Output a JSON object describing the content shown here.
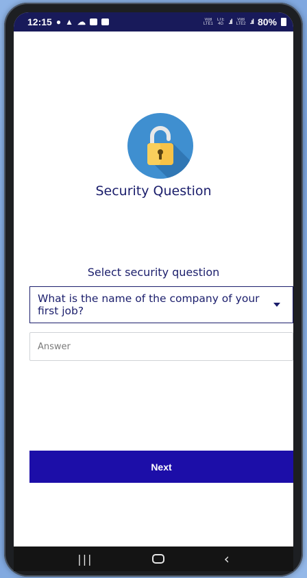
{
  "status_bar": {
    "time": "12:15",
    "network_1_top": "VoB",
    "network_1_bottom": "LTE1",
    "network_2_top": "LTE",
    "network_2_bottom": "4G",
    "network_3_top": "VoB",
    "network_3_bottom": "LTE2",
    "battery": "80%"
  },
  "screen": {
    "title": "Security Question",
    "select_label": "Select security question",
    "selected_question": "What is the name of the company of your first job?",
    "answer_placeholder": "Answer",
    "answer_value": "",
    "next_label": "Next"
  },
  "colors": {
    "primary": "#1c0ea8",
    "text_dark": "#1a1d6b",
    "icon_circle": "#3f8fd0",
    "lock_body": "#f7c247"
  },
  "icons": {
    "lock": "unlocked-padlock-icon",
    "dropdown": "caret-down-icon",
    "nav_recents": "recents-icon",
    "nav_home": "home-icon",
    "nav_back": "back-icon"
  }
}
